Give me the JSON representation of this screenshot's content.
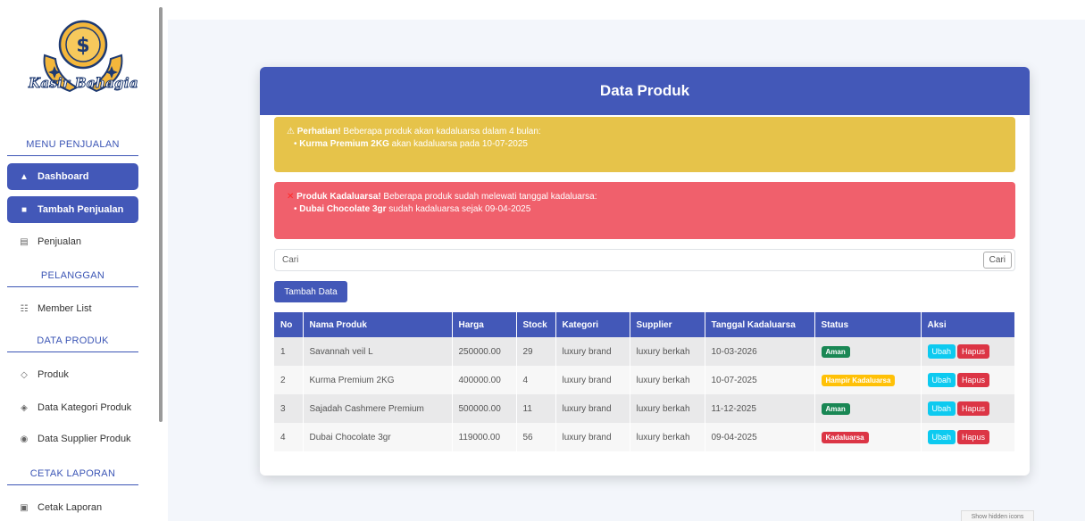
{
  "sidebar": {
    "logo_text": "Kasir Bahagia",
    "sections": {
      "menu_penjualan": "MENU PENJUALAN",
      "pelanggan": "PELANGGAN",
      "data_produk": "DATA PRODUK",
      "cetak_laporan": "CETAK LAPORAN"
    },
    "items": {
      "dashboard": "Dashboard",
      "tambah_penjualan": "Tambah Penjualan",
      "penjualan": "Penjualan",
      "member_list": "Member List",
      "produk": "Produk",
      "data_kategori": "Data Kategori Produk",
      "data_supplier": "Data Supplier Produk",
      "cetak_laporan": "Cetak Laporan"
    }
  },
  "card": {
    "title": "Data Produk"
  },
  "alerts": {
    "warning": {
      "icon": "⚠",
      "strong": "Perhatian!",
      "text": " Beberapa produk akan kadaluarsa dalam 4 bulan:",
      "item_name": "Kurma Premium 2KG",
      "item_text": " akan kadaluarsa pada 10-07-2025"
    },
    "danger": {
      "icon": "✕",
      "strong": "Produk Kadaluarsa!",
      "text": " Beberapa produk sudah melewati tanggal kadaluarsa:",
      "item_name": "Dubai Chocolate 3gr",
      "item_text": " sudah kadaluarsa sejak 09-04-2025"
    }
  },
  "search": {
    "placeholder": "Cari",
    "button": "Cari"
  },
  "add_button": "Tambah Data",
  "table": {
    "headers": {
      "no": "No",
      "nama": "Nama Produk",
      "harga": "Harga",
      "stock": "Stock",
      "kategori": "Kategori",
      "supplier": "Supplier",
      "tanggal": "Tanggal Kadaluarsa",
      "status": "Status",
      "aksi": "Aksi"
    },
    "rows": [
      {
        "no": "1",
        "nama": "Savannah veil L",
        "harga": "250000.00",
        "stock": "29",
        "kategori": "luxury brand",
        "supplier": "luxury berkah",
        "tanggal": "10-03-2026",
        "status": "Aman"
      },
      {
        "no": "2",
        "nama": "Kurma Premium 2KG",
        "harga": "400000.00",
        "stock": "4",
        "kategori": "luxury brand",
        "supplier": "luxury berkah",
        "tanggal": "10-07-2025",
        "status": "Hampir Kadaluarsa"
      },
      {
        "no": "3",
        "nama": "Sajadah Cashmere Premium",
        "harga": "500000.00",
        "stock": "11",
        "kategori": "luxury brand",
        "supplier": "luxury berkah",
        "tanggal": "11-12-2025",
        "status": "Aman"
      },
      {
        "no": "4",
        "nama": "Dubai Chocolate 3gr",
        "harga": "119000.00",
        "stock": "56",
        "kategori": "luxury brand",
        "supplier": "luxury berkah",
        "tanggal": "09-04-2025",
        "status": "Kadaluarsa"
      }
    ],
    "actions": {
      "edit": "Ubah",
      "delete": "Hapus"
    }
  },
  "taskbar": {
    "hidden_icons": "Show hidden icons"
  },
  "colors": {
    "primary": "#4358b8",
    "warning_alert": "#e6c34a",
    "danger_alert": "#f0606c",
    "status_aman": "#198754",
    "status_hampir": "#ffc107",
    "status_kadaluarsa": "#dc3545"
  }
}
